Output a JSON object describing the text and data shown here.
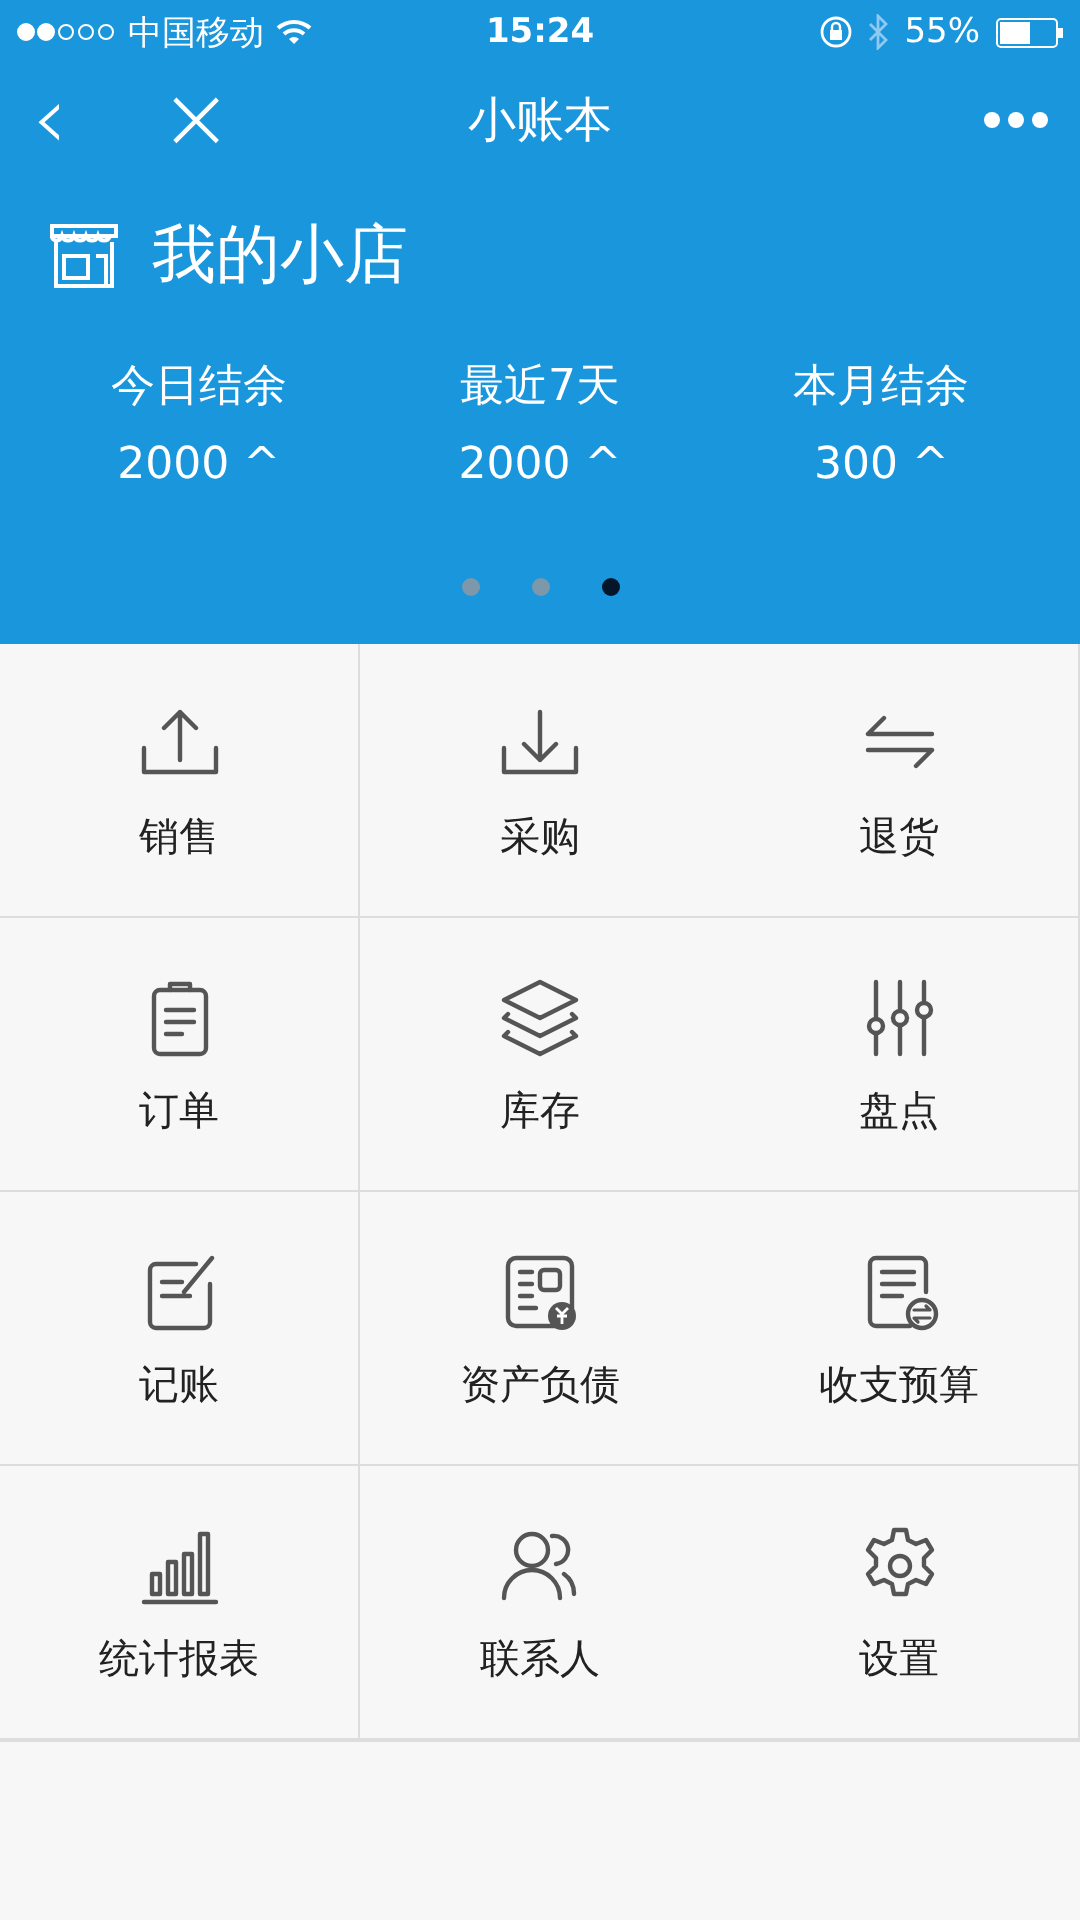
{
  "status_bar": {
    "carrier": "中国移动",
    "time": "15:24",
    "battery": "55%"
  },
  "nav_bar": {
    "title": "小账本",
    "back": "‹",
    "close": "×"
  },
  "shop": {
    "name": "我的小店"
  },
  "summary": [
    {
      "label": "今日结余",
      "value": "2000 ^"
    },
    {
      "label": "最近7天",
      "value": "2000 ^"
    },
    {
      "label": "本月结余",
      "value": "300 ^"
    }
  ],
  "page_dots": [
    {
      "selected": false
    },
    {
      "selected": false
    },
    {
      "selected": true
    }
  ],
  "menu": [
    {
      "label": "销售"
    },
    {
      "label": "采购"
    },
    {
      "label": "退货"
    },
    {
      "label": "订单"
    },
    {
      "label": "库存"
    },
    {
      "label": "盘点"
    },
    {
      "label": "记账"
    },
    {
      "label": "资产负债"
    },
    {
      "label": "收支预算"
    },
    {
      "label": "统计报表"
    },
    {
      "label": "联系人"
    },
    {
      "label": "设置"
    }
  ]
}
